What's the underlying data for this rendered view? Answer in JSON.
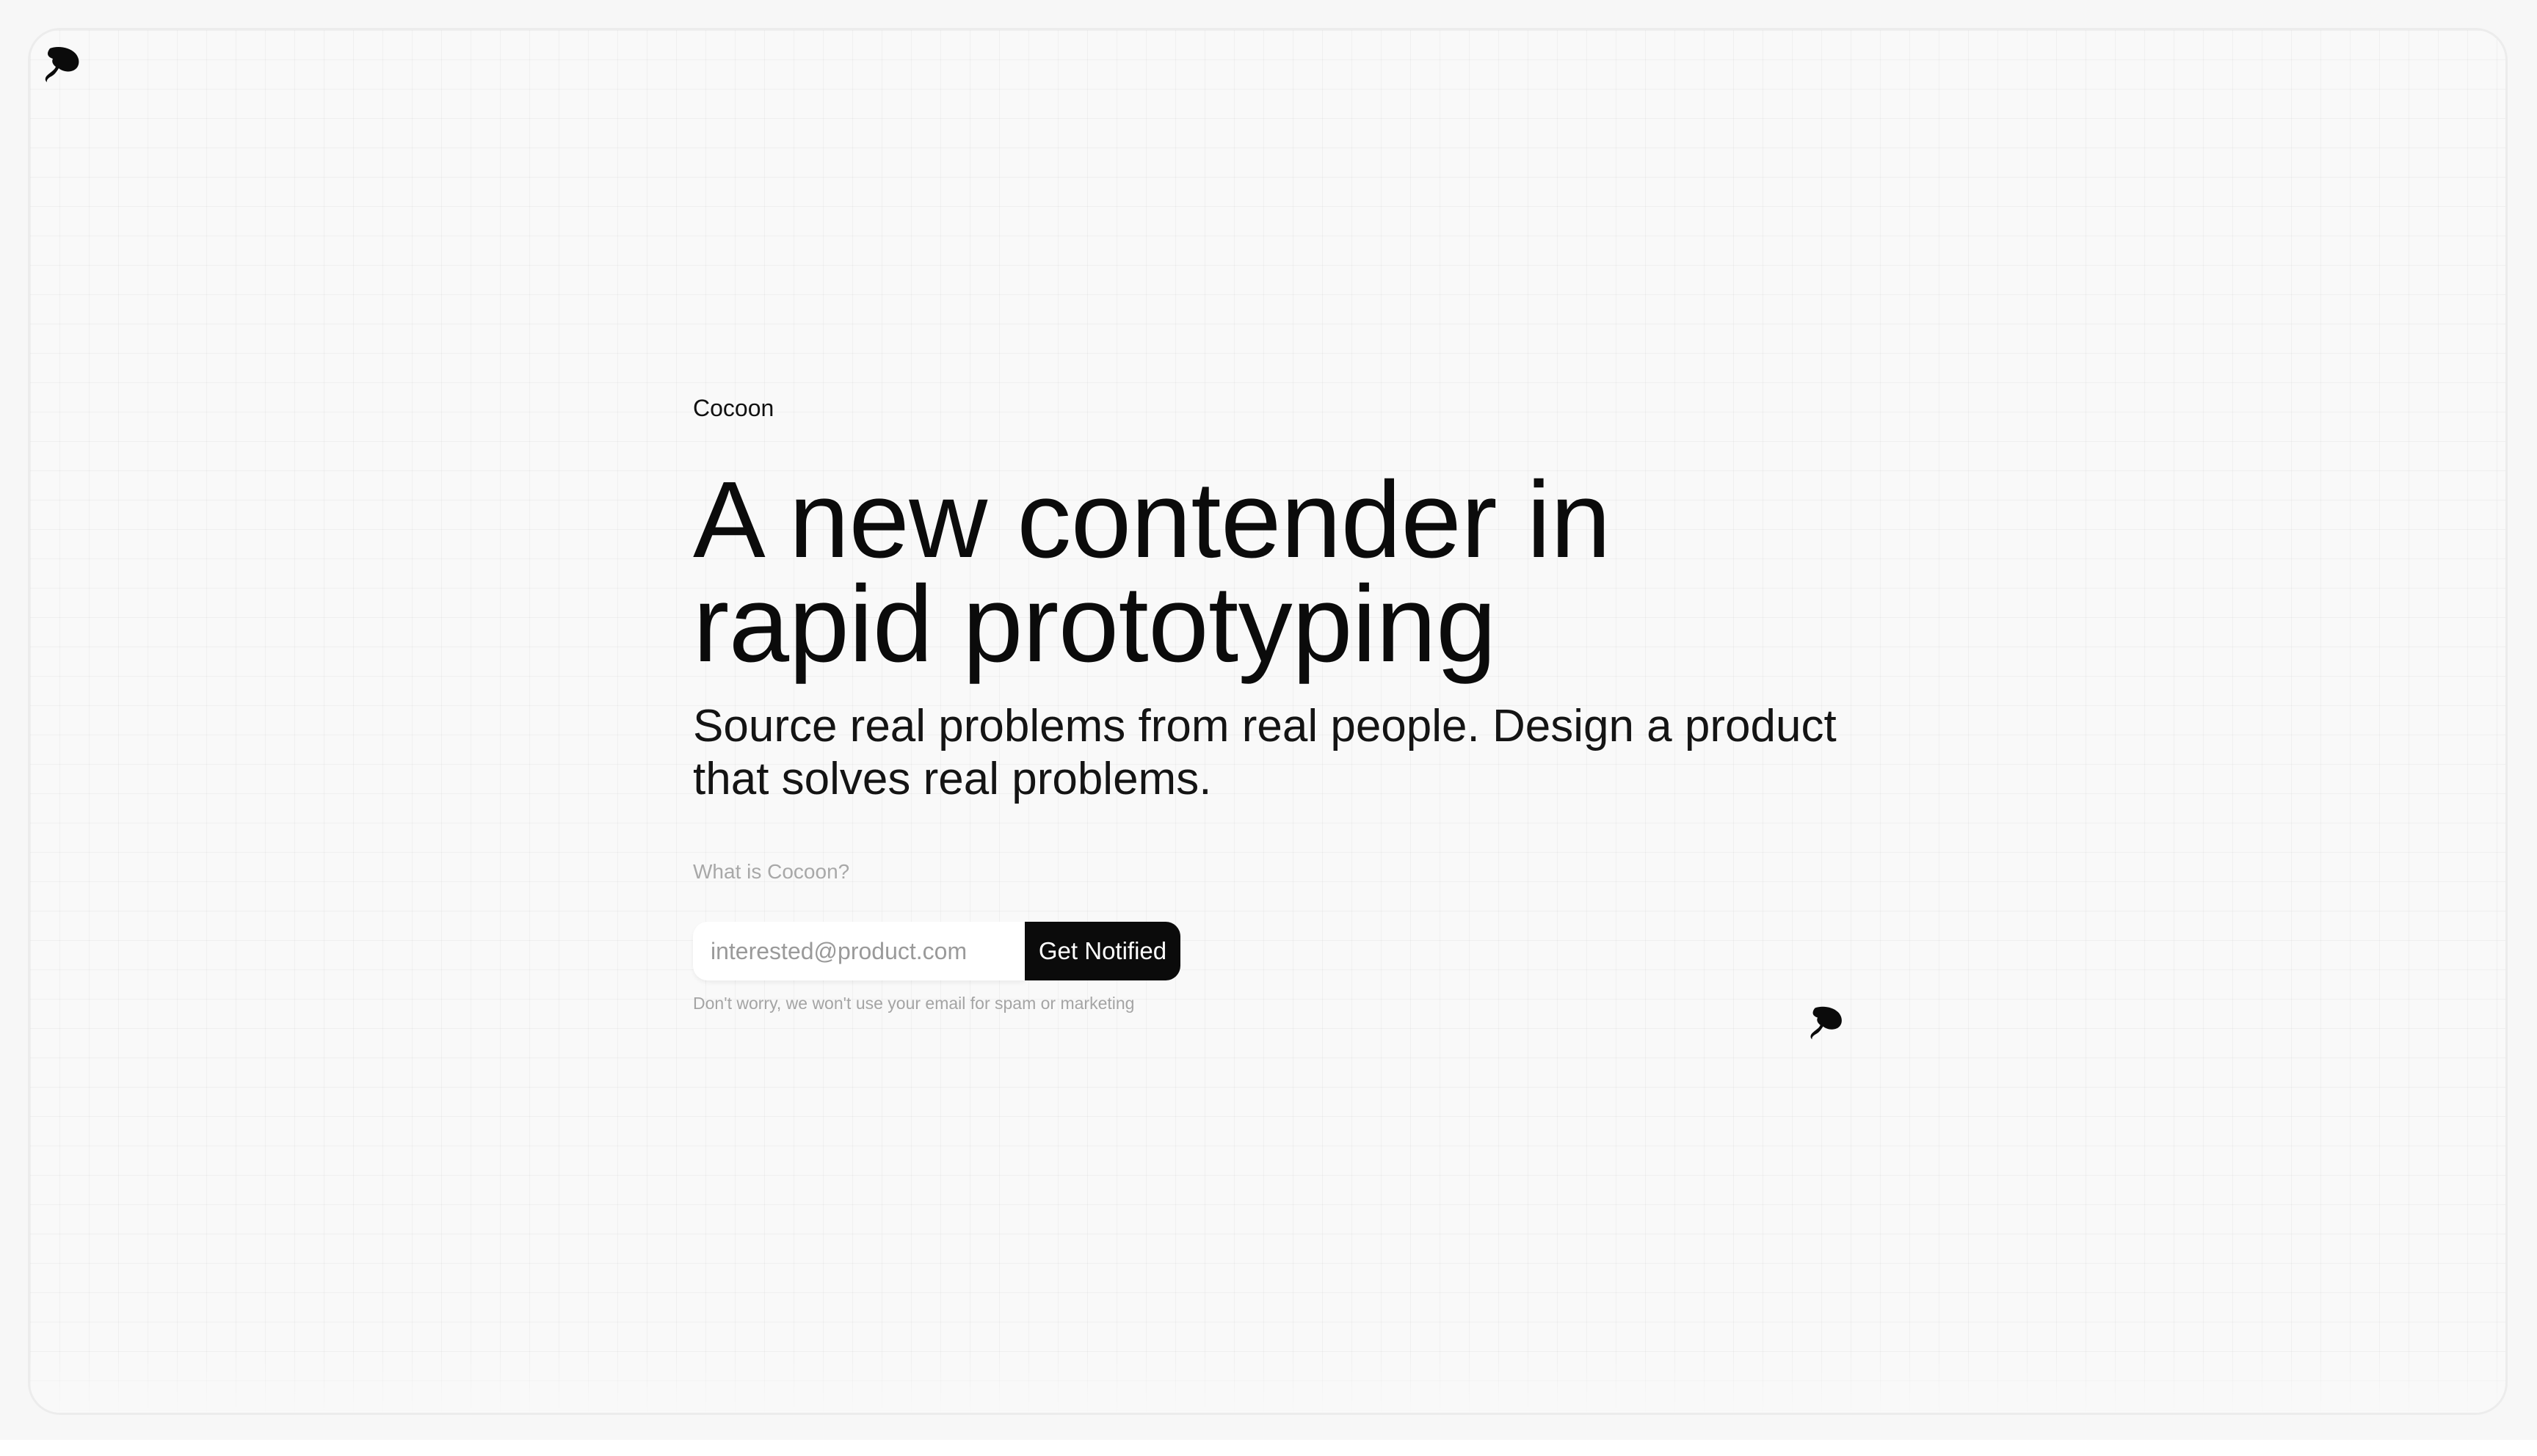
{
  "brand": {
    "name": "Cocoon"
  },
  "hero": {
    "headline_line1": "A new contender in",
    "headline_line2": "rapid prototyping",
    "subhead": "Source real problems from real people. Design a product that solves real problems.",
    "what_link": "What is Cocoon?"
  },
  "signup": {
    "placeholder": "interested@product.com",
    "value": "",
    "button_label": "Get Notified",
    "disclaimer": "Don't worry, we won't use your email for spam or marketing"
  },
  "icons": {
    "logo_top": "cocoon-logo-icon",
    "logo_mid": "cocoon-logo-icon"
  },
  "colors": {
    "background": "#f7f7f7",
    "text": "#0b0b0b",
    "button": "#0b0b0b",
    "button_text": "#ffffff",
    "muted": "#a8a8a8"
  }
}
